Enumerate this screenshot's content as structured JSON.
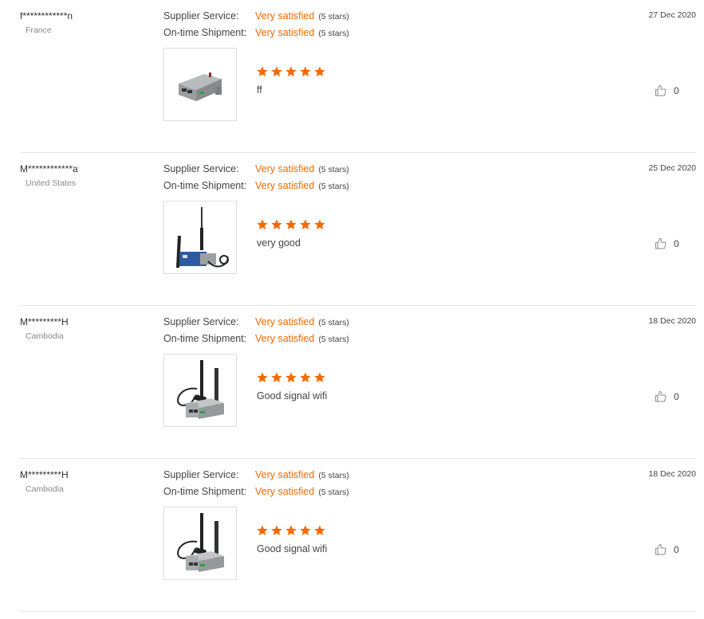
{
  "labels": {
    "supplier_service": "Supplier Service:",
    "on_time_shipment": "On-time Shipment:"
  },
  "colors": {
    "accent": "#f56a00",
    "divider": "#e5e5e5"
  },
  "reviews": [
    {
      "name": "f************n",
      "country": "France",
      "date": "27 Dec 2020",
      "supplier_service": "Very satisfied",
      "supplier_service_stars": "(5 stars)",
      "on_time_shipment": "Very satisfied",
      "on_time_shipment_stars": "(5 stars)",
      "rating": 5,
      "comment": "ff",
      "likes": "0",
      "product_icon": "router-box-icon"
    },
    {
      "name": "M************a",
      "country": "United States",
      "date": "25 Dec 2020",
      "supplier_service": "Very satisfied",
      "supplier_service_stars": "(5 stars)",
      "on_time_shipment": "Very satisfied",
      "on_time_shipment_stars": "(5 stars)",
      "rating": 5,
      "comment": "very good",
      "likes": "0",
      "product_icon": "router-antenna-icon"
    },
    {
      "name": "M*********H",
      "country": "Cambodia",
      "date": "18 Dec 2020",
      "supplier_service": "Very satisfied",
      "supplier_service_stars": "(5 stars)",
      "on_time_shipment": "Very satisfied",
      "on_time_shipment_stars": "(5 stars)",
      "rating": 5,
      "comment": "Good signal wifi",
      "likes": "0",
      "product_icon": "router-dual-antenna-icon"
    },
    {
      "name": "M*********H",
      "country": "Cambodia",
      "date": "18 Dec 2020",
      "supplier_service": "Very satisfied",
      "supplier_service_stars": "(5 stars)",
      "on_time_shipment": "Very satisfied",
      "on_time_shipment_stars": "(5 stars)",
      "rating": 5,
      "comment": "Good signal wifi",
      "likes": "0",
      "product_icon": "router-dual-antenna-icon"
    }
  ]
}
